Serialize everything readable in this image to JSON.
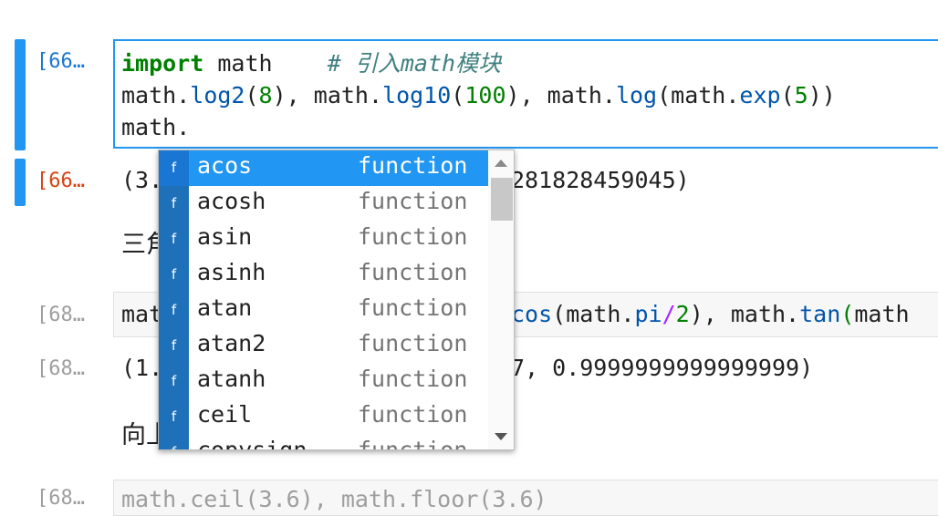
{
  "cells": [
    {
      "prompt": "[66…",
      "kind": "in"
    },
    {
      "prompt": "[66…",
      "kind": "out"
    },
    {
      "prompt": "[68…",
      "kind": "in-dim"
    },
    {
      "prompt": "[68…",
      "kind": "out-dim"
    },
    {
      "prompt": "[68…",
      "kind": "in-dim-partial"
    }
  ],
  "code": {
    "l1_kw": "import",
    "l1_mod": " math    ",
    "l1_comment": "# 引入math模块",
    "l2": [
      {
        "t": "math.",
        "c": "paren"
      },
      {
        "t": "log2",
        "c": "fn"
      },
      {
        "t": "(",
        "c": "paren"
      },
      {
        "t": "8",
        "c": "num"
      },
      {
        "t": "), math.",
        "c": "paren"
      },
      {
        "t": "log10",
        "c": "fn"
      },
      {
        "t": "(",
        "c": "paren"
      },
      {
        "t": "100",
        "c": "num"
      },
      {
        "t": "), math.",
        "c": "paren"
      },
      {
        "t": "log",
        "c": "fn"
      },
      {
        "t": "(math.",
        "c": "paren"
      },
      {
        "t": "exp",
        "c": "fn"
      },
      {
        "t": "(",
        "c": "paren"
      },
      {
        "t": "5",
        "c": "num"
      },
      {
        "t": "))",
        "c": "paren"
      }
    ],
    "l3": "math."
  },
  "output1_left": "(3.",
  "output1_right": "281828459045)",
  "heading1": "三角",
  "cell3_left": "mat",
  "cell3_right": [
    {
      "t": "cos",
      "c": "fn"
    },
    {
      "t": "(math.",
      "c": "paren"
    },
    {
      "t": "pi",
      "c": "fn"
    },
    {
      "t": "/",
      "c": "op"
    },
    {
      "t": "2",
      "c": "num"
    },
    {
      "t": "), math.",
      "c": "paren"
    },
    {
      "t": "tan",
      "c": "fn"
    },
    {
      "t": "(",
      "c": "num"
    },
    {
      "t": "math",
      "c": "paren"
    }
  ],
  "output2_left": "(1.",
  "output2_right": "7, 0.9999999999999999)",
  "heading2": "向上",
  "cell5_partial": "math.ceil(3.6), math.floor(3.6)",
  "completer": {
    "items": [
      {
        "type": "f",
        "label": "acos",
        "kind": "function",
        "active": true
      },
      {
        "type": "f",
        "label": "acosh",
        "kind": "function"
      },
      {
        "type": "f",
        "label": "asin",
        "kind": "function"
      },
      {
        "type": "f",
        "label": "asinh",
        "kind": "function"
      },
      {
        "type": "f",
        "label": "atan",
        "kind": "function"
      },
      {
        "type": "f",
        "label": "atan2",
        "kind": "function"
      },
      {
        "type": "f",
        "label": "atanh",
        "kind": "function"
      },
      {
        "type": "f",
        "label": "ceil",
        "kind": "function"
      },
      {
        "type": "f",
        "label": "copysign",
        "kind": "function"
      }
    ]
  },
  "colors": {
    "accent": "#2196f3",
    "keyword": "#008000",
    "function": "#0055aa",
    "number": "#008000",
    "comment": "#408080"
  }
}
